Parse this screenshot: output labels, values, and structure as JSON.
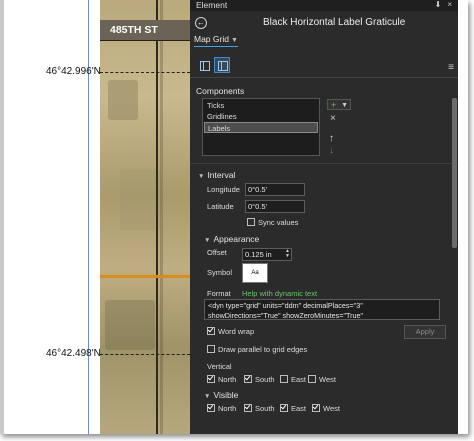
{
  "window": {
    "title": "Element",
    "controls": [
      "⬇",
      "×"
    ]
  },
  "panel": {
    "title": "Black Horizontal Label Graticule",
    "subtitle": "Map Grid",
    "tabs": [
      "grid-icon",
      "labels-icon"
    ],
    "components": {
      "header": "Components",
      "items": [
        "Ticks",
        "Gridlines",
        "Labels"
      ],
      "selected": "Labels",
      "buttons": {
        "add": "+",
        "remove": "×",
        "up": "↑",
        "down": "↓"
      }
    },
    "interval": {
      "header": "Interval",
      "longitude_label": "Longitude",
      "longitude_value": "0°0.5'",
      "latitude_label": "Latitude",
      "latitude_value": "0°0.5'",
      "sync_label": "Sync values",
      "sync_checked": false
    },
    "appearance": {
      "header": "Appearance",
      "offset_label": "Offset",
      "offset_value": "0.125 in",
      "symbol_label": "Symbol",
      "symbol_preview": "Aa",
      "format_label": "Format",
      "help_link": "Help with dynamic text",
      "format_value": "<dyn type=\"grid\" units=\"ddm\" decimalPlaces=\"3\" showDirections=\"True\" showZeroMinutes=\"True\" showZeroSeconds=\"True\"/>",
      "word_wrap_label": "Word wrap",
      "word_wrap_checked": true,
      "apply_label": "Apply",
      "draw_parallel_label": "Draw parallel to grid edges",
      "draw_parallel_checked": false
    },
    "vertical": {
      "header": "Vertical",
      "options": [
        {
          "label": "North",
          "checked": true
        },
        {
          "label": "South",
          "checked": true
        },
        {
          "label": "East",
          "checked": false
        },
        {
          "label": "West",
          "checked": false
        }
      ]
    },
    "visible": {
      "header": "Visible",
      "options": [
        {
          "label": "North",
          "checked": true
        },
        {
          "label": "South",
          "checked": true
        },
        {
          "label": "East",
          "checked": true
        },
        {
          "label": "West",
          "checked": true
        }
      ]
    }
  },
  "map": {
    "street_label": "485TH ST",
    "lat_labels": [
      "46°42.996'N",
      "46°42.498'N"
    ]
  },
  "colors": {
    "panel_bg": "#2b2b2b",
    "accent": "#3c8bd0",
    "link": "#6cc26c",
    "road": "#d98c1e"
  }
}
